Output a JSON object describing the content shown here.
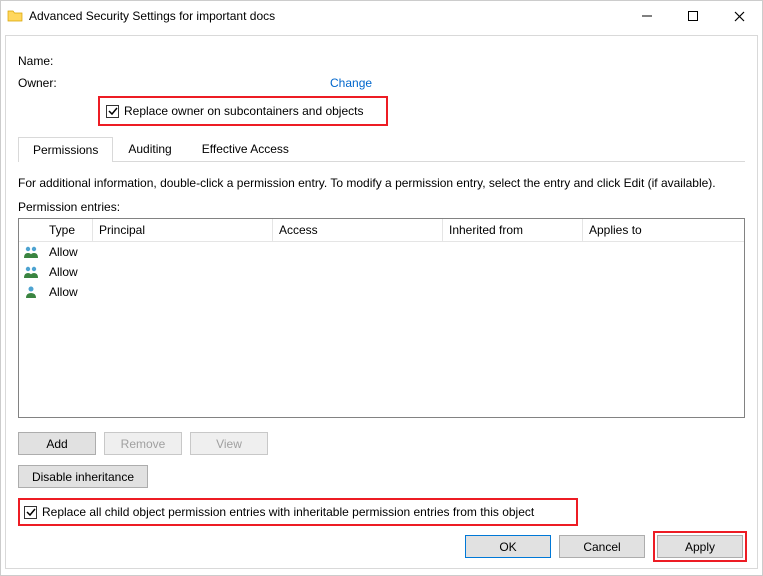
{
  "window": {
    "title": "Advanced Security Settings for important docs"
  },
  "name_label": "Name:",
  "owner_label": "Owner:",
  "change_link": "Change",
  "replace_owner_cb": "Replace owner on subcontainers and objects",
  "tabs": {
    "permissions": "Permissions",
    "auditing": "Auditing",
    "effective": "Effective Access"
  },
  "info_text": "For additional information, double-click a permission entry. To modify a permission entry, select the entry and click Edit (if available).",
  "entries_label": "Permission entries:",
  "columns": {
    "type": "Type",
    "principal": "Principal",
    "access": "Access",
    "inherited": "Inherited from",
    "applies": "Applies to"
  },
  "rows": [
    {
      "type": "Allow",
      "icon": "group"
    },
    {
      "type": "Allow",
      "icon": "group"
    },
    {
      "type": "Allow",
      "icon": "user"
    }
  ],
  "buttons": {
    "add": "Add",
    "remove": "Remove",
    "view": "View",
    "disable_inherit": "Disable inheritance",
    "ok": "OK",
    "cancel": "Cancel",
    "apply": "Apply"
  },
  "replace_child_cb": "Replace all child object permission entries with inheritable permission entries from this object"
}
